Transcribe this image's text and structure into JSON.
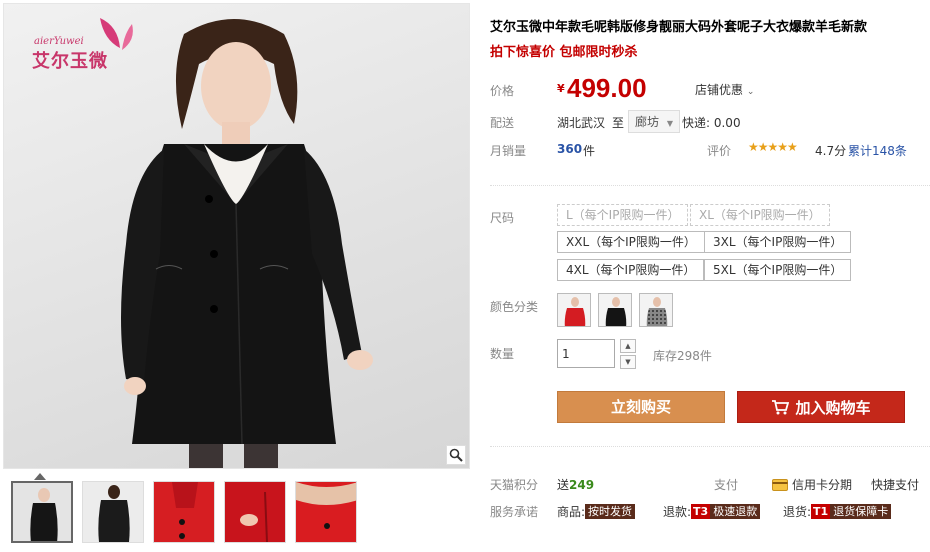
{
  "brand": {
    "latin": "aierYuwei",
    "cn": "艾尔玉微"
  },
  "product": {
    "title": "艾尔玉微中年款毛呢韩版修身靓丽大码外套呢子大衣爆款羊毛新款",
    "subtitle": "拍下惊喜价 包邮限时秒杀"
  },
  "price": {
    "label": "价格",
    "currency": "¥",
    "value": "499.00",
    "shop_discount": "店铺优惠"
  },
  "shipping": {
    "label": "配送",
    "from": "湖北武汉",
    "to_label": "至",
    "to": "廊坊",
    "fee": "快递: 0.00"
  },
  "sales": {
    "label": "月销量",
    "count": "360",
    "unit": "件"
  },
  "rating": {
    "label": "评价",
    "stars": "★★★★★",
    "score": "4.7分",
    "reviews": "累计148条"
  },
  "size": {
    "label": "尺码",
    "options": [
      {
        "label": "L（每个IP限购一件）",
        "available": false
      },
      {
        "label": "XL（每个IP限购一件）",
        "available": false
      },
      {
        "label": "XXL（每个IP限购一件）",
        "available": true
      },
      {
        "label": "3XL（每个IP限购一件）",
        "available": true
      },
      {
        "label": "4XL（每个IP限购一件）",
        "available": true
      },
      {
        "label": "5XL（每个IP限购一件）",
        "available": true
      }
    ]
  },
  "color": {
    "label": "颜色分类",
    "swatches": [
      "red",
      "black",
      "gray-plaid"
    ]
  },
  "quantity": {
    "label": "数量",
    "value": "1",
    "stock": "库存298件"
  },
  "buttons": {
    "buy_now": "立刻购买",
    "add_cart": "加入购物车"
  },
  "points": {
    "label": "天猫积分",
    "prefix": "送",
    "value": "249"
  },
  "payment": {
    "label": "支付",
    "credit": "信用卡分期",
    "quick": "快捷支付"
  },
  "promise": {
    "label": "服务承诺",
    "items": [
      {
        "prefix": "商品:",
        "badge": "",
        "text": "按时发货"
      },
      {
        "prefix": "退款:",
        "badge": "T3",
        "text": "极速退款"
      },
      {
        "prefix": "退货:",
        "badge": "T1",
        "text": "退货保障卡"
      }
    ]
  },
  "colors": {
    "price": "#c40000",
    "buy_btn": "#d88f4f",
    "cart_btn": "#c4281a",
    "link": "#2953a6"
  },
  "thumbnails": [
    "black-coat-front",
    "black-coat-back",
    "red-coat-collar",
    "red-coat-pocket",
    "red-coat-detail"
  ]
}
